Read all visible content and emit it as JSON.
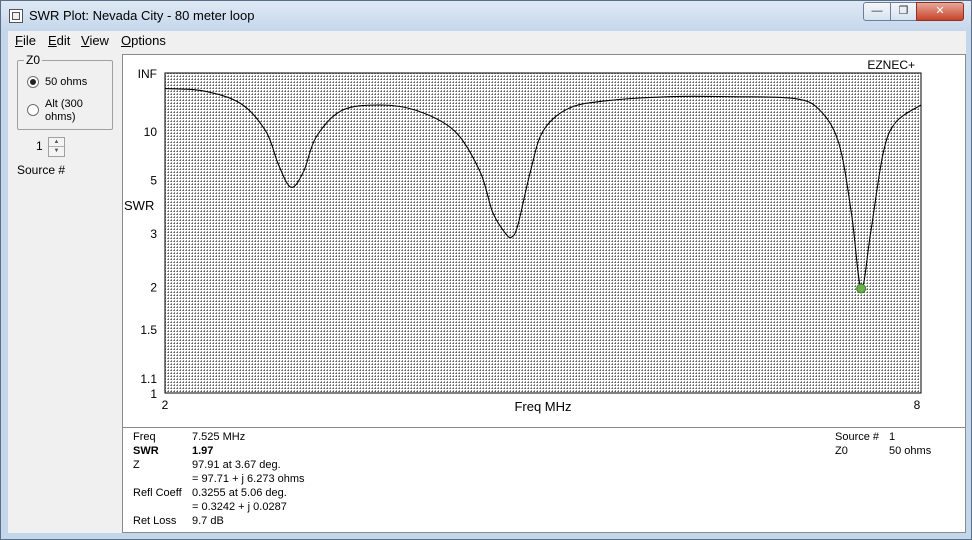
{
  "window": {
    "title": "SWR Plot: Nevada City - 80 meter loop",
    "minimize": "—",
    "maximize": "❐",
    "close": "✕"
  },
  "menu": [
    {
      "label": "File",
      "key": "F",
      "rest": "ile"
    },
    {
      "label": "Edit",
      "key": "E",
      "rest": "dit"
    },
    {
      "label": "View",
      "key": "V",
      "rest": "iew"
    },
    {
      "label": "Options",
      "key": "O",
      "rest": "ptions"
    }
  ],
  "z0_group": {
    "legend": "Z0",
    "option_50": "50 ohms",
    "option_alt_line1": "Alt (300",
    "option_alt_line2": "ohms)",
    "selected": "50 ohms"
  },
  "source": {
    "value": "1",
    "label": "Source #"
  },
  "plot": {
    "brand": "EZNEC+",
    "ylabel": "SWR",
    "xlabel": "Freq MHz",
    "y_tick_labels": [
      "INF",
      "10",
      "5",
      "3",
      "2",
      "1.5",
      "1.1",
      "1"
    ],
    "x_tick_labels": [
      "2",
      "8"
    ],
    "curve_color": "#000000",
    "marker_color": "#6ab04c",
    "grid_color": "#000000"
  },
  "chart_data": {
    "type": "line",
    "xlabel": "Freq MHz",
    "ylabel": "SWR",
    "xlim": [
      2,
      8
    ],
    "y_scale": "reflection-coefficient (SWR)",
    "y_ticks": [
      "1",
      "1.1",
      "1.5",
      "2",
      "3",
      "5",
      "10",
      "INF"
    ],
    "grid": true,
    "series": [
      {
        "x": [
          2.0,
          2.3,
          2.6,
          2.8,
          2.9,
          3.0,
          3.1,
          3.2,
          3.4,
          3.7,
          4.0,
          4.3,
          4.5,
          4.6,
          4.7,
          4.75,
          4.8,
          4.9,
          5.0,
          5.2,
          5.5,
          6.0,
          6.5,
          7.0,
          7.2,
          7.35,
          7.45,
          7.525,
          7.6,
          7.7,
          7.8,
          8.0
        ],
        "y": [
          40,
          35,
          20,
          10,
          6,
          4.6,
          5.5,
          9,
          16,
          19,
          16,
          10,
          5.5,
          3.6,
          3.0,
          2.9,
          3.2,
          5.5,
          10,
          17,
          22,
          26,
          26,
          24,
          16,
          8,
          3.5,
          1.97,
          3,
          7,
          12,
          19
        ]
      }
    ],
    "marker": {
      "x": 7.525,
      "y": 1.97
    }
  },
  "readout": {
    "freq_label": "Freq",
    "freq_value": "7.525 MHz",
    "swr_label": "SWR",
    "swr_value": "1.97",
    "z_label": "Z",
    "z_value1": "97.91 at 3.67 deg.",
    "z_value2": "= 97.71 + j 6.273 ohms",
    "refl_label": "Refl Coeff",
    "refl_value1": "0.3255 at 5.06 deg.",
    "refl_value2": "= 0.3242 + j 0.0287",
    "retloss_label": "Ret Loss",
    "retloss_value": "9.7 dB",
    "source_label": "Source #",
    "source_value": "1",
    "z0_label": "Z0",
    "z0_value": "50 ohms"
  }
}
